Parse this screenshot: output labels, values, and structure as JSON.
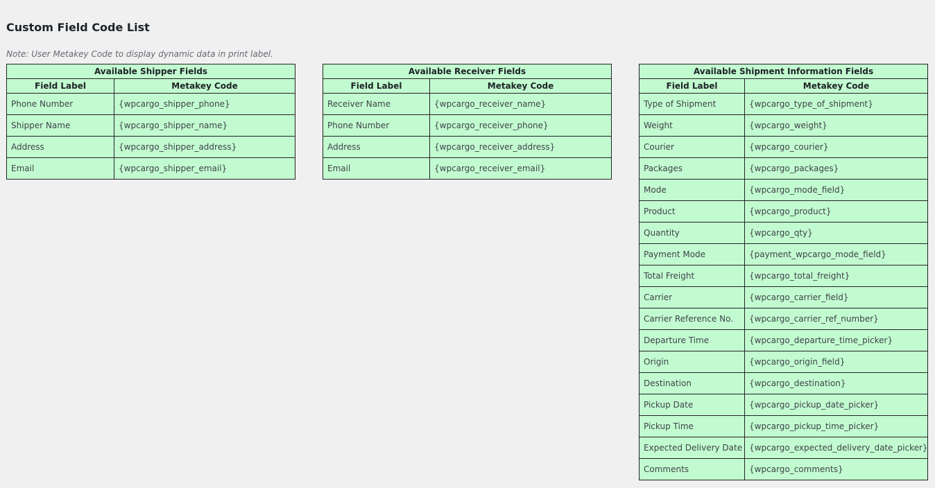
{
  "title": "Custom Field Code List",
  "note": "Note: User Metakey Code to display dynamic data in print label.",
  "column_headers": {
    "label": "Field Label",
    "code": "Metakey Code"
  },
  "tables": {
    "shipper": {
      "caption": "Available Shipper Fields",
      "rows": [
        {
          "label": "Phone Number",
          "code": "{wpcargo_shipper_phone}"
        },
        {
          "label": "Shipper Name",
          "code": "{wpcargo_shipper_name}"
        },
        {
          "label": "Address",
          "code": "{wpcargo_shipper_address}"
        },
        {
          "label": "Email",
          "code": "{wpcargo_shipper_email}"
        }
      ]
    },
    "receiver": {
      "caption": "Available Receiver Fields",
      "rows": [
        {
          "label": "Receiver Name",
          "code": "{wpcargo_receiver_name}"
        },
        {
          "label": "Phone Number",
          "code": "{wpcargo_receiver_phone}"
        },
        {
          "label": "Address",
          "code": "{wpcargo_receiver_address}"
        },
        {
          "label": "Email",
          "code": "{wpcargo_receiver_email}"
        }
      ]
    },
    "shipment": {
      "caption": "Available Shipment Information Fields",
      "rows": [
        {
          "label": "Type of Shipment",
          "code": "{wpcargo_type_of_shipment}"
        },
        {
          "label": "Weight",
          "code": "{wpcargo_weight}"
        },
        {
          "label": "Courier",
          "code": "{wpcargo_courier}"
        },
        {
          "label": "Packages",
          "code": "{wpcargo_packages}"
        },
        {
          "label": "Mode",
          "code": "{wpcargo_mode_field}"
        },
        {
          "label": "Product",
          "code": "{wpcargo_product}"
        },
        {
          "label": "Quantity",
          "code": "{wpcargo_qty}"
        },
        {
          "label": "Payment Mode",
          "code": "{payment_wpcargo_mode_field}"
        },
        {
          "label": "Total Freight",
          "code": "{wpcargo_total_freight}"
        },
        {
          "label": "Carrier",
          "code": "{wpcargo_carrier_field}"
        },
        {
          "label": "Carrier Reference No.",
          "code": "{wpcargo_carrier_ref_number}"
        },
        {
          "label": "Departure Time",
          "code": "{wpcargo_departure_time_picker}"
        },
        {
          "label": "Origin",
          "code": "{wpcargo_origin_field}"
        },
        {
          "label": "Destination",
          "code": "{wpcargo_destination}"
        },
        {
          "label": "Pickup Date",
          "code": "{wpcargo_pickup_date_picker}"
        },
        {
          "label": "Pickup Time",
          "code": "{wpcargo_pickup_time_picker}"
        },
        {
          "label": "Expected Delivery Date",
          "code": "{wpcargo_expected_delivery_date_picker}"
        },
        {
          "label": "Comments",
          "code": "{wpcargo_comments}"
        }
      ]
    }
  },
  "colors": {
    "table_bg": "#c3fbd0",
    "page_bg": "#f0f0f1",
    "border": "#222222"
  }
}
